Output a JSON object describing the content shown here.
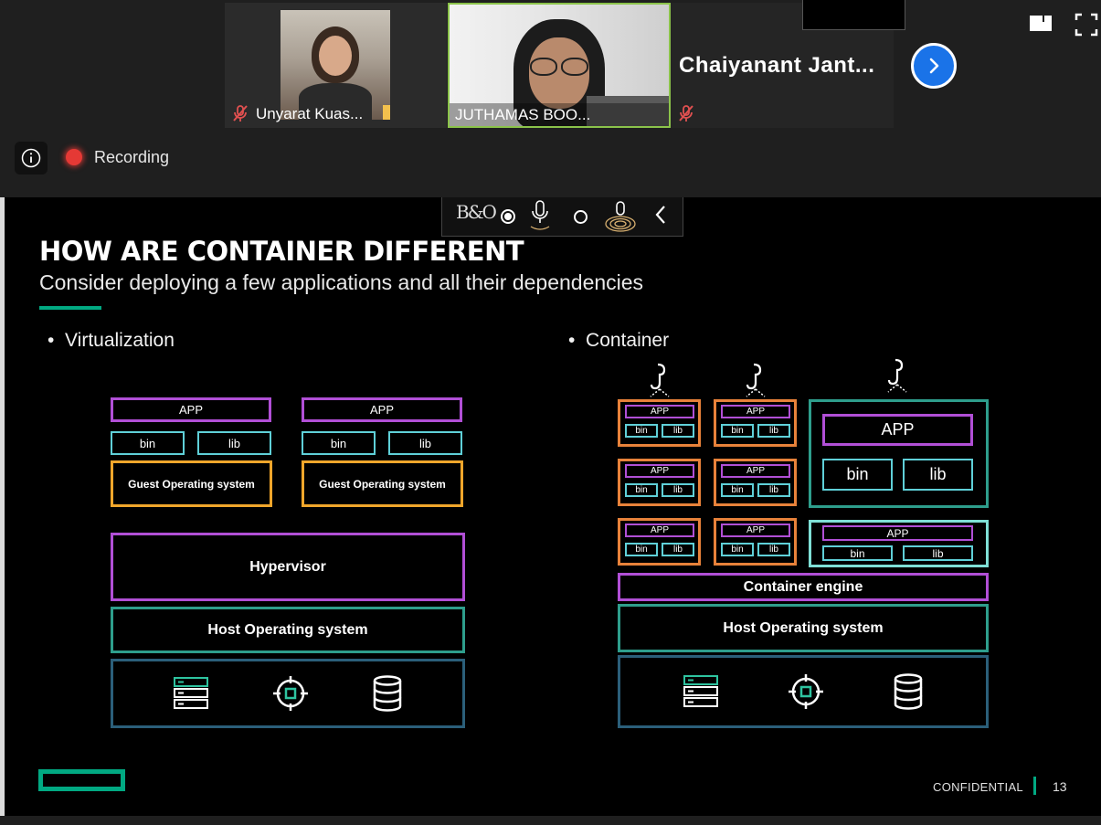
{
  "meeting": {
    "participants": [
      {
        "name": "Unyarat Kuas...",
        "muted": true
      },
      {
        "name": "JUTHAMAS BOO...",
        "muted": false,
        "active_speaker": true
      },
      {
        "name": "Chaiyanant  Jant...",
        "muted": true
      }
    ],
    "recording_label": "Recording",
    "icons": [
      "info-icon",
      "recording-dot-icon",
      "mic-off-icon",
      "chevron-right-icon",
      "layout-icon",
      "fullscreen-icon"
    ]
  },
  "slide": {
    "title": "HOW ARE CONTAINER DIFFERENT",
    "subtitle": "Consider deploying a few applications  and all their dependencies",
    "virtualization": {
      "label": "Virtualization",
      "app": "APP",
      "bin": "bin",
      "lib": "lib",
      "guest_os": "Guest Operating system",
      "hypervisor": "Hypervisor",
      "host_os": "Host Operating system"
    },
    "container": {
      "label": "Container",
      "app": "APP",
      "bin": "bin",
      "lib": "lib",
      "engine": "Container engine",
      "host_os": "Host Operating system"
    },
    "footer": {
      "confidential": "CONFIDENTIAL",
      "page": "13"
    },
    "toolbar": {
      "logo": "B&O"
    },
    "colors": {
      "accent": "#01a982",
      "purple": "#b14fd6",
      "orange": "#f0a62b",
      "container_orange": "#e8823a",
      "teal": "#2e9e8c",
      "hardware_border": "#2b5f7a"
    }
  }
}
